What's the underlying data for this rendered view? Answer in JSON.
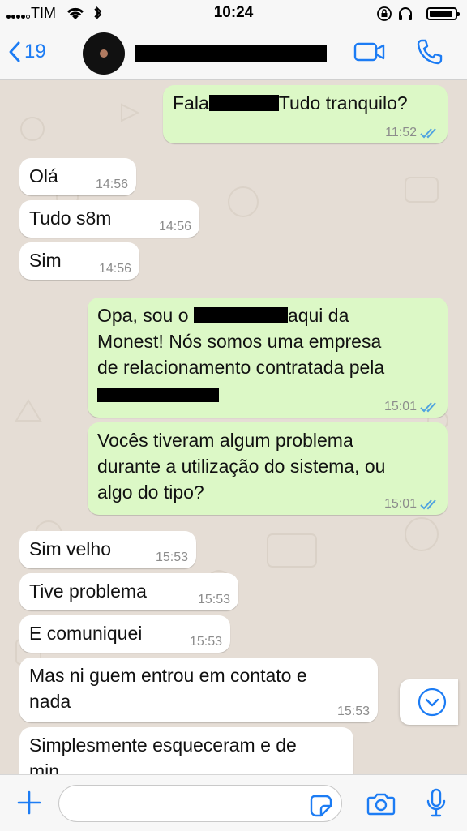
{
  "status": {
    "carrier": "TIM",
    "time": "10:24"
  },
  "header": {
    "back_count": "19"
  },
  "messages": [
    {
      "dir": "out",
      "pre": "Fala",
      "post": "Tudo tranquilo?",
      "time": "11:52"
    },
    {
      "dir": "in",
      "text": "Olá",
      "time": "14:56"
    },
    {
      "dir": "in",
      "text": "Tudo s8m",
      "time": "14:56"
    },
    {
      "dir": "in",
      "text": "Sim",
      "time": "14:56"
    },
    {
      "dir": "out",
      "line1_pre": "Opa, sou o",
      "line1_post": "aqui da",
      "line2": "Monest! Nós somos uma empresa",
      "line3": "de relacionamento contratada pela",
      "time": "15:01"
    },
    {
      "dir": "out",
      "line1": "Vocês tiveram algum problema",
      "line2": "durante a utilização do sistema, ou",
      "line3": "algo do tipo?",
      "time": "15:01"
    },
    {
      "dir": "in",
      "text": "Sim velho",
      "time": "15:53"
    },
    {
      "dir": "in",
      "text": "Tive problema",
      "time": "15:53"
    },
    {
      "dir": "in",
      "text": "E comuniquei",
      "time": "15:53"
    },
    {
      "dir": "in",
      "line1": "Mas ni guem entrou em contato e",
      "line2": "nada",
      "time": "15:53"
    },
    {
      "dir": "in",
      "line1": "Simplesmente esqueceram e de",
      "line2": "min"
    }
  ],
  "colors": {
    "accent": "#1c7cf4",
    "outgoing_bubble": "#dcf8c6",
    "incoming_bubble": "#ffffff",
    "read_ticks": "#4fa3e0"
  },
  "icons": [
    "back-chevron-icon",
    "video-call-icon",
    "phone-icon",
    "chevron-down-icon",
    "plus-icon",
    "sticker-icon",
    "camera-icon",
    "microphone-icon"
  ]
}
